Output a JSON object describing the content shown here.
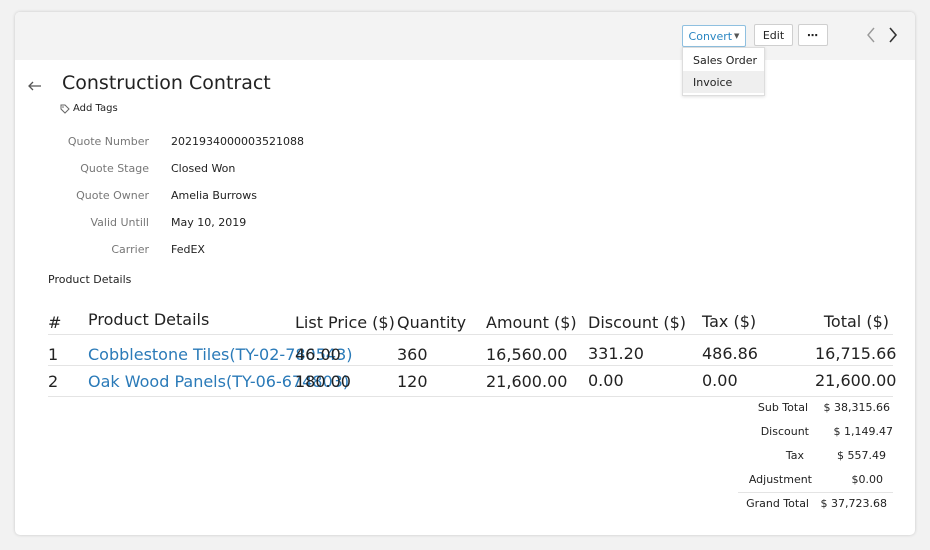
{
  "toolbar": {
    "convert_label": "Convert",
    "edit_label": "Edit",
    "more_label": "⋯"
  },
  "convert_menu": {
    "items": [
      {
        "label": "Sales Order"
      },
      {
        "label": "Invoice"
      }
    ]
  },
  "record": {
    "title": "Construction Contract",
    "add_tags_label": "Add Tags"
  },
  "fields": [
    {
      "label": "Quote Number",
      "value": "2021934000003521088"
    },
    {
      "label": "Quote Stage",
      "value": "Closed Won"
    },
    {
      "label": "Quote Owner",
      "value": "Amelia Burrows"
    },
    {
      "label": "Valid Untill",
      "value": "May 10, 2019"
    },
    {
      "label": "Carrier",
      "value": "FedEX"
    }
  ],
  "products": {
    "section_title": "Product Details",
    "columns": {
      "num": "#",
      "product": "Product Details",
      "list_price": "List Price ($)",
      "quantity": "Quantity",
      "amount": "Amount ($)",
      "discount": "Discount ($)",
      "tax": "Tax ($)",
      "total": "Total ($)"
    },
    "rows": [
      {
        "num": "1",
        "product": "Cobblestone Tiles",
        "code": "(TY-02-780543)",
        "list_price": "46.00",
        "quantity": "360",
        "amount": "16,560.00",
        "discount": "331.20",
        "tax": "486.86",
        "total": "16,715.66"
      },
      {
        "num": "2",
        "product": "Oak Wood Panels",
        "code": "(TY-06-674803)",
        "list_price": "180.00",
        "quantity": "120",
        "amount": "21,600.00",
        "discount": "0.00",
        "tax": "0.00",
        "total": "21,600.00"
      }
    ]
  },
  "totals": {
    "sub_total_label": "Sub Total",
    "sub_total": "$ 38,315.66",
    "discount_label": "Discount",
    "discount": "$ 1,149.47",
    "tax_label": "Tax",
    "tax": "$ 557.49",
    "adjustment_label": "Adjustment",
    "adjustment": "$0.00",
    "grand_total_label": "Grand Total",
    "grand_total": "$ 37,723.68"
  },
  "colors": {
    "link": "#2a7ab8",
    "accent": "#2a86c2"
  }
}
